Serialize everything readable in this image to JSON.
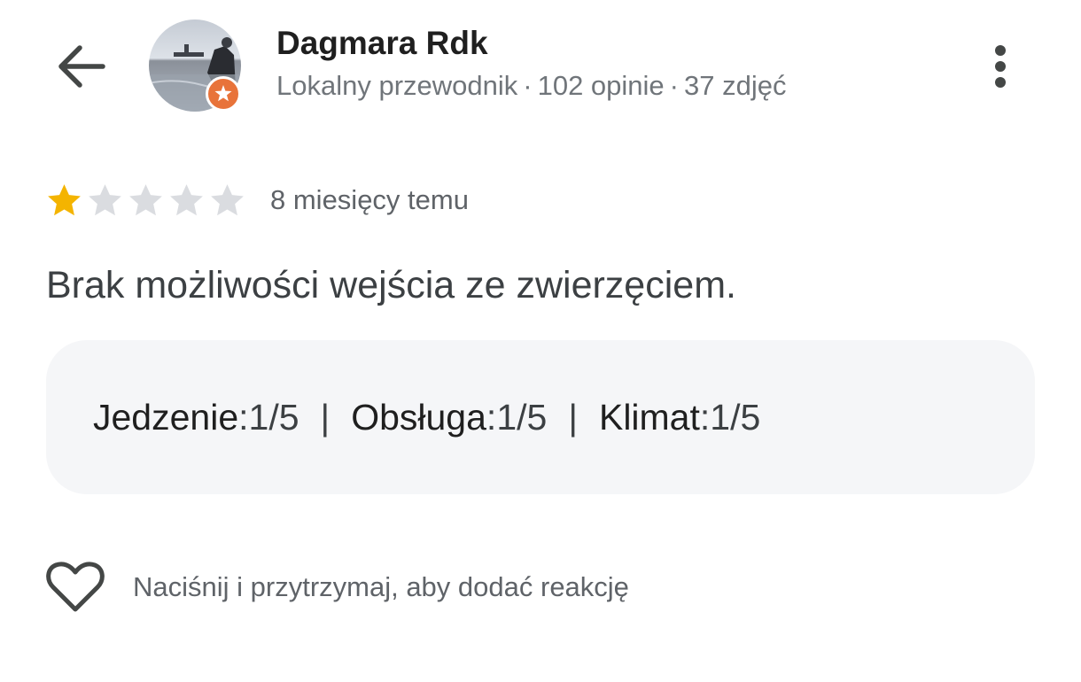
{
  "header": {
    "back_icon": "arrow-left-icon",
    "user_name": "Dagmara Rdk",
    "user_level": "Lokalny przewodnik",
    "reviews_count": "102 opinie",
    "photos_count": "37 zdjęć",
    "separator": "·",
    "more_icon": "more-vert-icon",
    "badge_icon": "local-guide-star-icon"
  },
  "review": {
    "rating": 1,
    "rating_max": 5,
    "time_ago": "8 miesięcy temu",
    "text": "Brak możliwości wejścia ze zwierzęciem.",
    "aspects": [
      {
        "label": "Jedzenie",
        "value": "1/5"
      },
      {
        "label": "Obsługa",
        "value": "1/5"
      },
      {
        "label": "Klimat",
        "value": "1/5"
      }
    ],
    "aspect_separator": "|"
  },
  "reaction": {
    "icon": "heart-outline-icon",
    "hint": "Naciśnij i przytrzymaj, aby dodać reakcję"
  },
  "colors": {
    "star_filled": "#f4b400",
    "star_empty": "#dadce0",
    "badge": "#e8733a",
    "box_background": "#f5f6f8"
  }
}
